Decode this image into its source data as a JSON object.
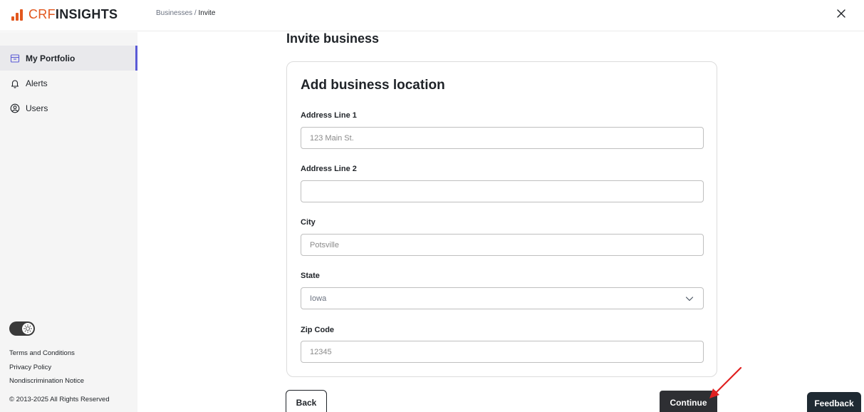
{
  "brand": {
    "prefix": "CRF",
    "suffix": "INSIGHTS",
    "accent_color": "#e2571e"
  },
  "breadcrumb": {
    "parent": "Businesses",
    "separator": " / ",
    "current": "Invite"
  },
  "header": {
    "close_icon": "close-icon"
  },
  "sidebar": {
    "items": [
      {
        "label": "My Portfolio",
        "icon": "store-icon",
        "active": true
      },
      {
        "label": "Alerts",
        "icon": "bell-icon",
        "active": false
      },
      {
        "label": "Users",
        "icon": "user-circle-icon",
        "active": false
      }
    ],
    "theme_toggle_icon": "sun-icon",
    "footer_links": [
      "Terms and Conditions",
      "Privacy Policy",
      "Nondiscrimination Notice"
    ],
    "copyright": "© 2013-2025 All Rights Reserved"
  },
  "main": {
    "page_title": "Invite business",
    "card_title": "Add business location",
    "fields": {
      "address1": {
        "label": "Address Line 1",
        "placeholder": "123 Main St.",
        "value": ""
      },
      "address2": {
        "label": "Address Line 2",
        "placeholder": "",
        "value": ""
      },
      "city": {
        "label": "City",
        "placeholder": "Potsville",
        "value": ""
      },
      "state": {
        "label": "State",
        "selected": "Iowa"
      },
      "zip": {
        "label": "Zip Code",
        "placeholder": "12345",
        "value": ""
      }
    },
    "back_label": "Back",
    "continue_label": "Continue"
  },
  "feedback_label": "Feedback",
  "annotation_color": "#e02020"
}
